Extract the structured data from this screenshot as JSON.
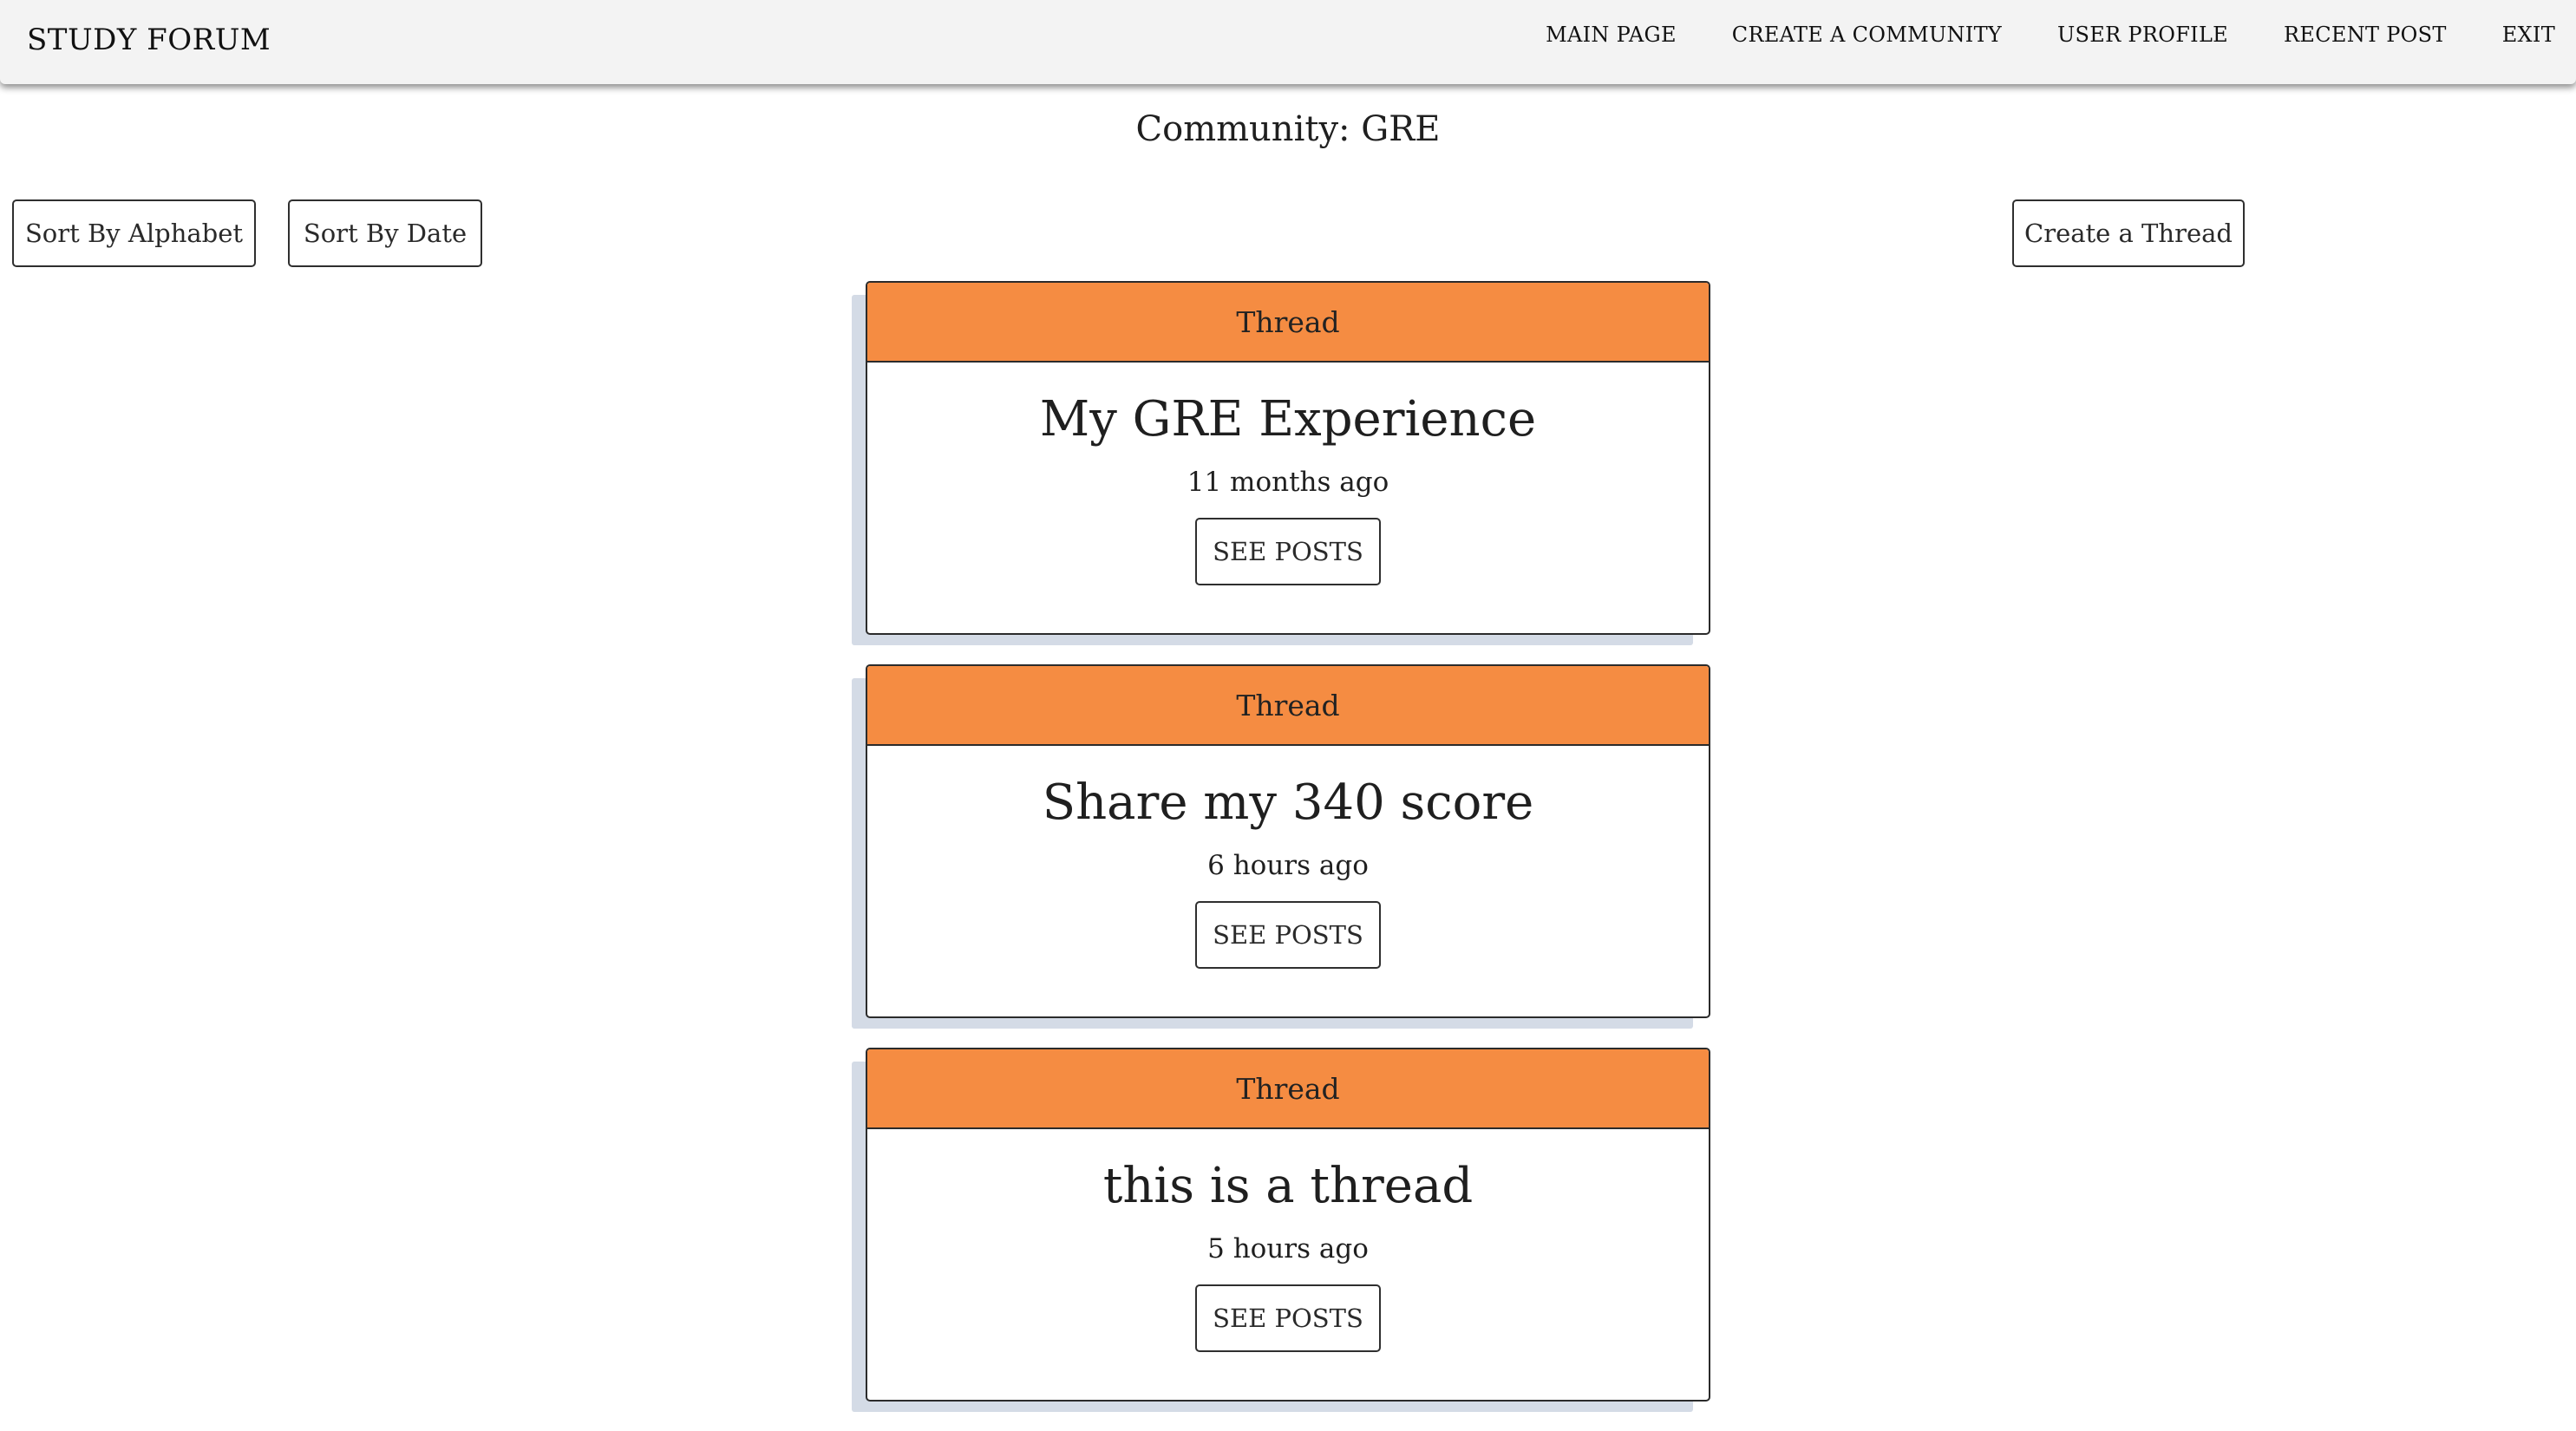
{
  "navbar": {
    "brand": "STUDY FORUM",
    "links": [
      {
        "label": "MAIN PAGE"
      },
      {
        "label": "CREATE A COMMUNITY"
      },
      {
        "label": "USER PROFILE"
      },
      {
        "label": "RECENT POST"
      },
      {
        "label": "EXIT"
      }
    ]
  },
  "page": {
    "title": "Community: GRE"
  },
  "toolbar": {
    "sort_alphabet_label": "Sort By Alphabet",
    "sort_date_label": "Sort By Date",
    "create_thread_label": "Create a Thread"
  },
  "threads": [
    {
      "header": "Thread",
      "title": "My GRE Experience",
      "time": "11 months ago",
      "button": "SEE POSTS"
    },
    {
      "header": "Thread",
      "title": "Share my 340 score",
      "time": "6 hours ago",
      "button": "SEE POSTS"
    },
    {
      "header": "Thread",
      "title": "this is a thread",
      "time": "5 hours ago",
      "button": "SEE POSTS"
    }
  ],
  "colors": {
    "card_header": "#f58c42",
    "navbar_bg": "#f3f3f3",
    "card_shadow": "#d4dbe6"
  }
}
